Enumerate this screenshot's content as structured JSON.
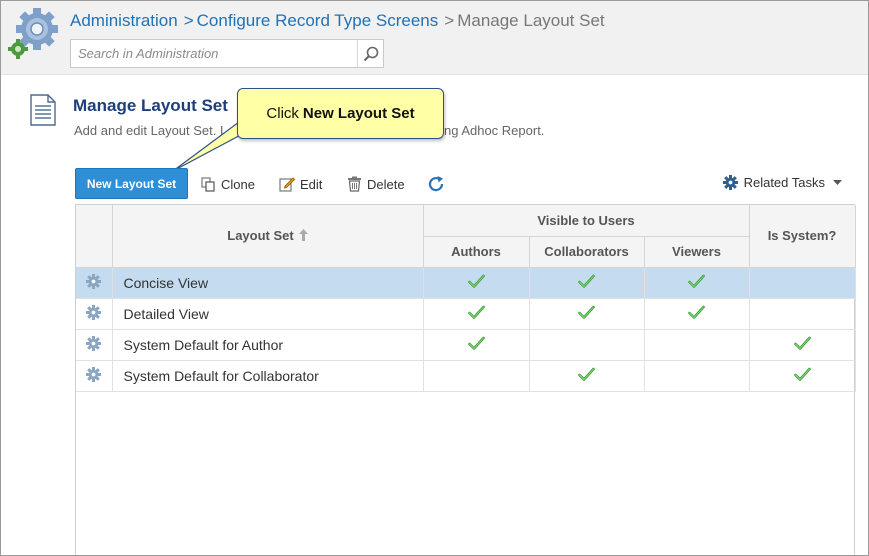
{
  "breadcrumb": {
    "items": [
      "Administration",
      "Configure Record Type Screens"
    ],
    "separator": ">",
    "current": "Manage Layout Set"
  },
  "search": {
    "placeholder": "Search in Administration"
  },
  "page": {
    "title": "Manage Layout Set",
    "description": "Add and edit Layout Set. L",
    "description_end": "ating Adhoc Report."
  },
  "callout": {
    "prefix": "Click",
    "target": "New Layout Set"
  },
  "toolbar": {
    "new_label": "New Layout Set",
    "clone_label": "Clone",
    "edit_label": "Edit",
    "delete_label": "Delete",
    "related_label": "Related Tasks"
  },
  "grid": {
    "header_layout": "Layout Set",
    "header_visible": "Visible to Users",
    "header_authors": "Authors",
    "header_collaborators": "Collaborators",
    "header_viewers": "Viewers",
    "header_system": "Is System?",
    "rows": [
      {
        "name": "Concise View",
        "authors": true,
        "collaborators": true,
        "viewers": true,
        "system": false,
        "selected": true
      },
      {
        "name": "Detailed View",
        "authors": true,
        "collaborators": true,
        "viewers": true,
        "system": false,
        "selected": false
      },
      {
        "name": "System Default for Author",
        "authors": true,
        "collaborators": false,
        "viewers": false,
        "system": true,
        "selected": false
      },
      {
        "name": "System Default for Collaborator",
        "authors": false,
        "collaborators": true,
        "viewers": false,
        "system": true,
        "selected": false
      }
    ]
  },
  "colors": {
    "link": "#1f72b8",
    "primary": "#2e8fd6",
    "title": "#1f3f7a",
    "selected_row": "#c5dcf0",
    "callout_bg": "#ffffa6",
    "check": "#3aa33a"
  }
}
